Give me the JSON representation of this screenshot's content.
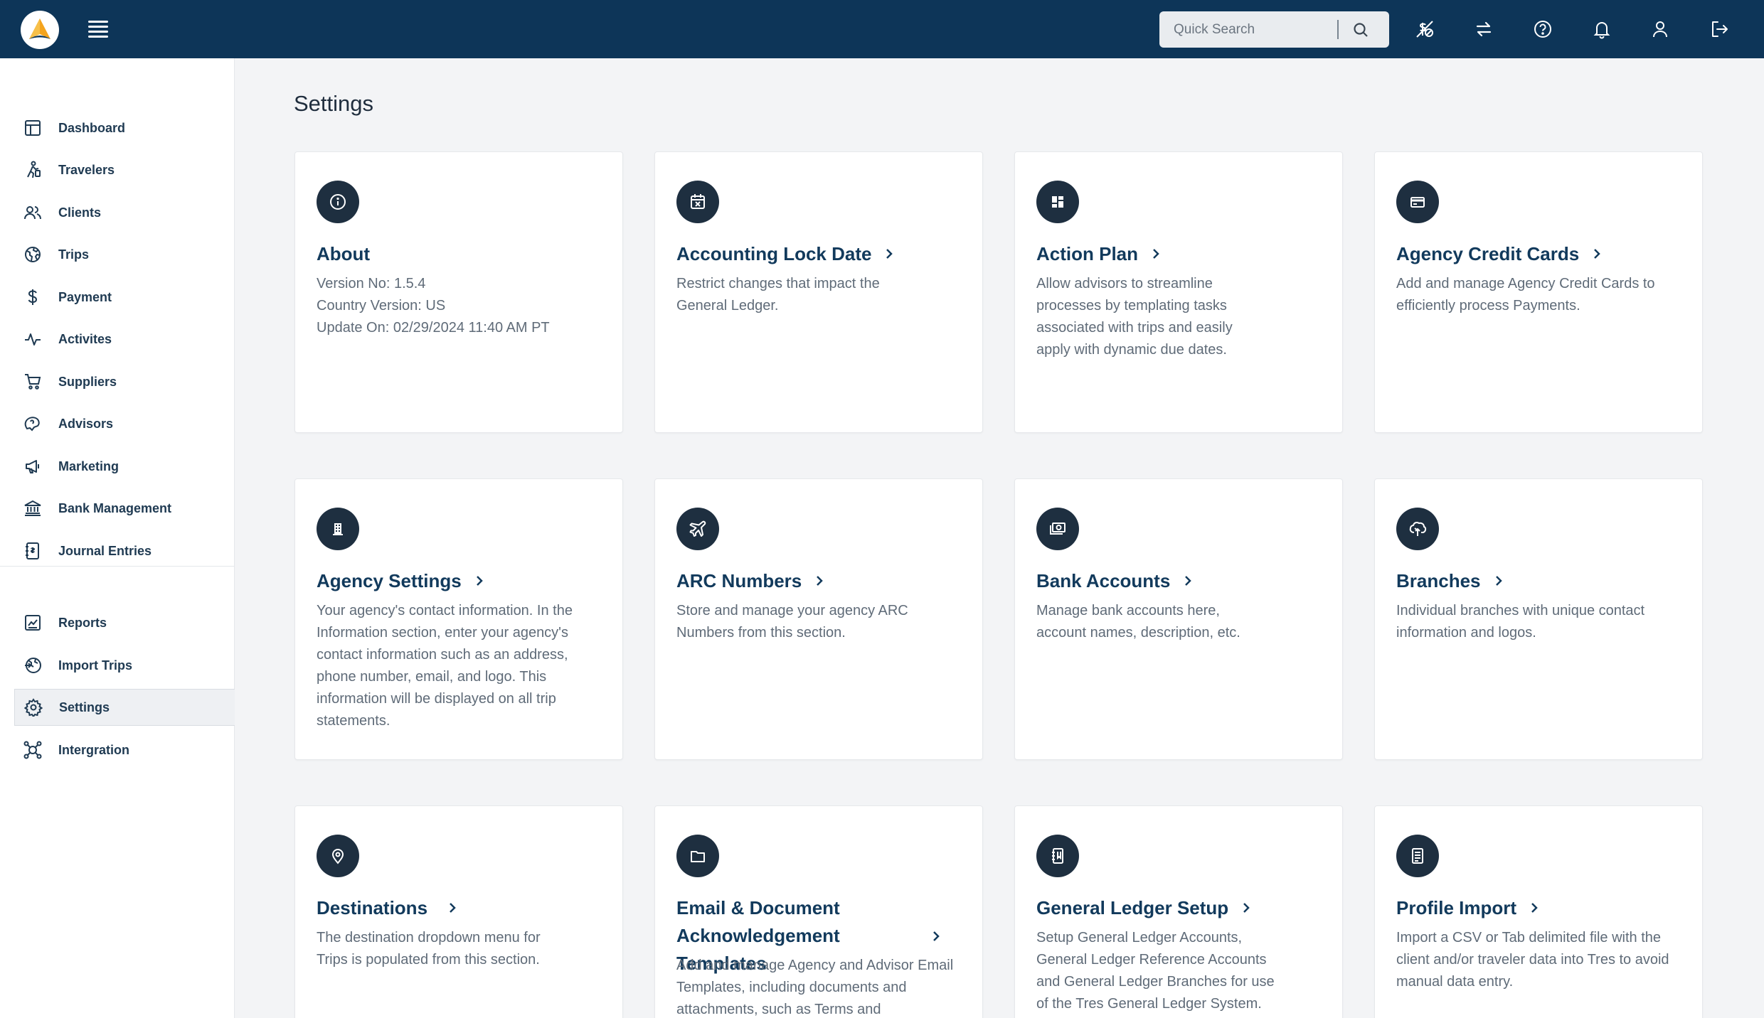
{
  "search": {
    "placeholder": "Quick Search"
  },
  "header": {
    "icons": [
      "no-cost-icon",
      "transfer-icon",
      "help-icon",
      "bell-icon",
      "user-icon",
      "logout-icon"
    ]
  },
  "sidebar": {
    "items": [
      {
        "label": "Dashboard",
        "icon": "dashboard-icon"
      },
      {
        "label": "Travelers",
        "icon": "traveler-icon"
      },
      {
        "label": "Clients",
        "icon": "clients-icon"
      },
      {
        "label": "Trips",
        "icon": "globe-icon"
      },
      {
        "label": "Payment",
        "icon": "dollar-icon"
      },
      {
        "label": "Activites",
        "icon": "activity-icon"
      },
      {
        "label": "Suppliers",
        "icon": "cart-icon"
      },
      {
        "label": "Advisors",
        "icon": "advisor-icon"
      },
      {
        "label": "Marketing",
        "icon": "megaphone-icon"
      },
      {
        "label": "Bank Management",
        "icon": "bank-icon"
      },
      {
        "label": "Journal Entries",
        "icon": "journal-icon"
      },
      {
        "label": "Reports",
        "icon": "reports-icon"
      },
      {
        "label": "Import Trips",
        "icon": "import-icon"
      },
      {
        "label": "Settings",
        "icon": "gear-icon",
        "active": true
      },
      {
        "label": "Intergration",
        "icon": "integration-icon"
      }
    ]
  },
  "main": {
    "title": "Settings",
    "cards": [
      {
        "title": "About",
        "desc": [
          "Version No: 1.5.4",
          "Country Version: US",
          "Update On: 02/29/2024 11:40 AM PT"
        ],
        "icon": "info-icon"
      },
      {
        "title": "Accounting Lock Date",
        "desc": [
          "Restrict changes that impact the",
          "General Ledger."
        ],
        "icon": "calendar-icon"
      },
      {
        "title": "Action Plan",
        "desc": [
          "Allow advisors to streamline",
          "processes by templating tasks",
          "associated with trips and easily",
          "apply with dynamic due dates."
        ],
        "icon": "grid-icon"
      },
      {
        "title": "Agency Credit Cards",
        "desc": [
          "Add and manage Agency Credit Cards to",
          "efficiently process Payments."
        ],
        "icon": "credit-card-icon"
      },
      {
        "title": "Agency Settings",
        "desc": [
          "Your agency's contact information. In the",
          "Information section, enter your agency's",
          "contact information such as an address,",
          "phone number, email, and logo. This",
          "information will be displayed on all trip",
          "statements."
        ],
        "icon": "building-icon"
      },
      {
        "title": "ARC Numbers",
        "desc": [
          "Store and manage your agency ARC",
          "Numbers from this section."
        ],
        "icon": "plane-icon"
      },
      {
        "title": "Bank Accounts",
        "desc": [
          "Manage bank accounts here,",
          "account names, description, etc."
        ],
        "icon": "money-icon"
      },
      {
        "title": "Branches",
        "desc": [
          "Individual branches with unique contact",
          "information and logos."
        ],
        "icon": "branch-icon"
      },
      {
        "title": "Destinations",
        "desc": [
          "The destination dropdown menu for",
          "Trips is populated from this section."
        ],
        "icon": "pin-icon"
      },
      {
        "title": "Email & Document Acknowledgement Templates",
        "title_lines": [
          "Email & Document",
          "Acknowledgement Templates"
        ],
        "desc": [
          "Add and manage Agency and Advisor Email",
          "Templates, including documents and",
          "attachments, such as Terms and"
        ],
        "icon": "folder-icon"
      },
      {
        "title": "General Ledger Setup",
        "desc": [
          "Setup General Ledger Accounts,",
          "General Ledger Reference Accounts",
          "and General Ledger Branches for use",
          "of the Tres General Ledger System."
        ],
        "icon": "ledger-icon"
      },
      {
        "title": "Profile Import",
        "desc": [
          "Import a CSV or Tab delimited file with the",
          "client and/or traveler data into Tres to avoid",
          "manual data entry."
        ],
        "icon": "document-icon"
      }
    ]
  }
}
